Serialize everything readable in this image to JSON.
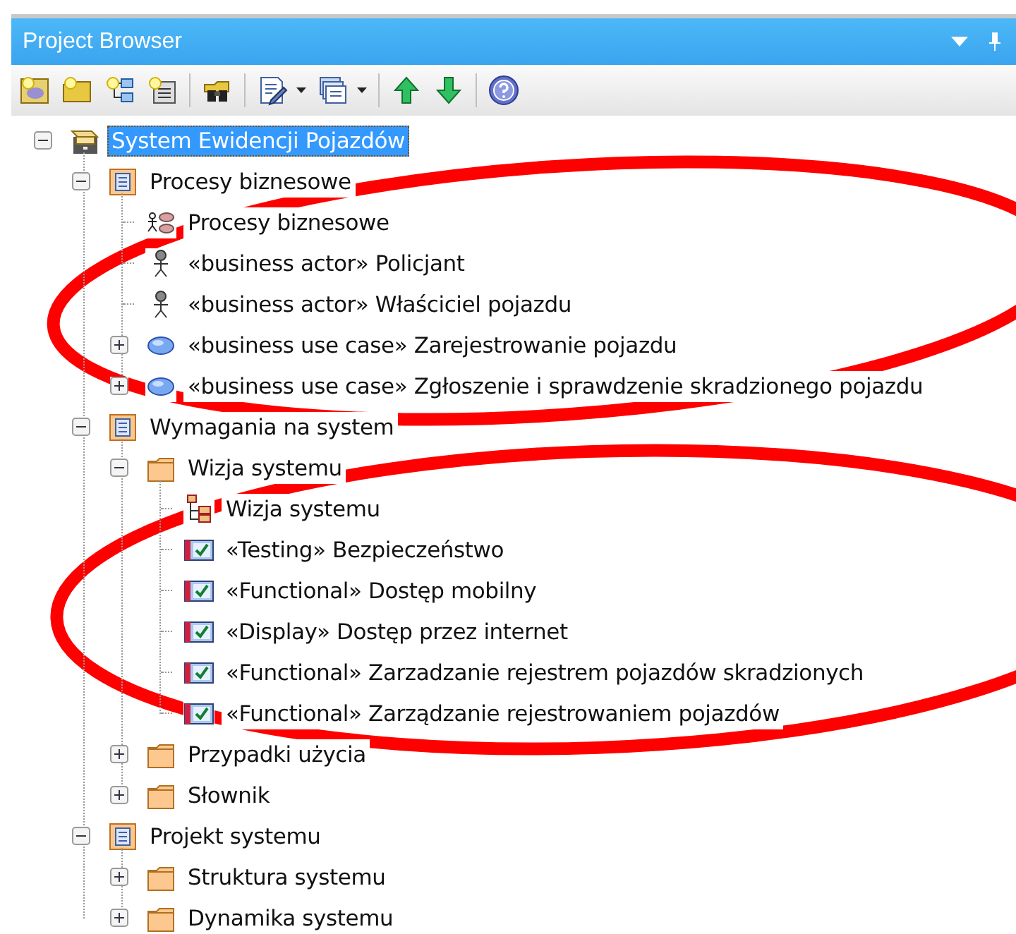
{
  "panel": {
    "title": "Project Browser"
  },
  "tree": [
    {
      "label": "System Ewidencji Pojazdów",
      "kind": "model",
      "selected": true,
      "expanded": true,
      "children": [
        {
          "label": "Procesy biznesowe",
          "kind": "package",
          "selected": false,
          "expanded": true,
          "children": [
            {
              "label": "Procesy biznesowe",
              "kind": "process-diagram",
              "selected": false
            },
            {
              "label": "«business actor» Policjant",
              "kind": "actor",
              "selected": false
            },
            {
              "label": "«business actor» Właściciel pojazdu",
              "kind": "actor",
              "selected": false
            },
            {
              "label": "«business use case» Zarejestrowanie pojazdu",
              "kind": "usecase",
              "selected": false,
              "expanded": false
            },
            {
              "label": "«business use case» Zgłoszenie i sprawdzenie skradzionego pojazdu",
              "kind": "usecase",
              "selected": false,
              "expanded": false
            }
          ]
        },
        {
          "label": "Wymagania na system",
          "kind": "package",
          "selected": false,
          "expanded": true,
          "children": [
            {
              "label": "Wizja systemu",
              "kind": "folder",
              "selected": false,
              "expanded": true,
              "children": [
                {
                  "label": "Wizja systemu",
                  "kind": "hierarchy-diagram",
                  "selected": false
                },
                {
                  "label": "«Testing» Bezpieczeństwo",
                  "kind": "requirement",
                  "selected": false
                },
                {
                  "label": "«Functional» Dostęp mobilny",
                  "kind": "requirement",
                  "selected": false
                },
                {
                  "label": "«Display» Dostęp przez internet",
                  "kind": "requirement",
                  "selected": false
                },
                {
                  "label": "«Functional» Zarzadzanie rejestrem pojazdów skradzionych",
                  "kind": "requirement",
                  "selected": false
                },
                {
                  "label": "«Functional» Zarządzanie rejestrowaniem pojazdów",
                  "kind": "requirement",
                  "selected": false
                }
              ]
            },
            {
              "label": "Przypadki użycia",
              "kind": "folder",
              "selected": false,
              "expanded": false
            },
            {
              "label": "Słownik",
              "kind": "folder",
              "selected": false,
              "expanded": false
            }
          ]
        },
        {
          "label": "Projekt systemu",
          "kind": "package",
          "selected": false,
          "expanded": true,
          "children": [
            {
              "label": "Struktura systemu",
              "kind": "folder",
              "selected": false,
              "expanded": false
            },
            {
              "label": "Dynamika systemu",
              "kind": "folder",
              "selected": false,
              "expanded": false
            }
          ]
        }
      ]
    }
  ]
}
